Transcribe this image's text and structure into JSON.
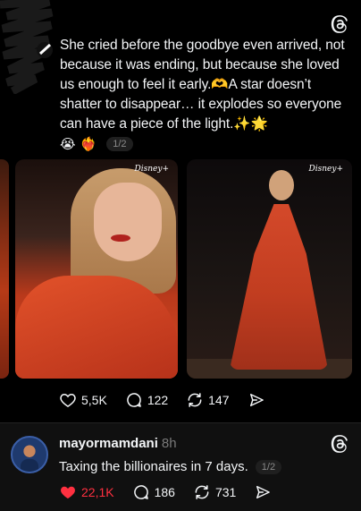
{
  "post1": {
    "text": "She cried before the goodbye even arrived, not because it was ending, but because she loved us enough to feel it early.🫶A star doesn’t shatter to disappear… it explodes so everyone can have a piece of the light.✨🌟",
    "reactions": [
      "😭",
      "❤️‍🔥"
    ],
    "pager": "1/2",
    "media": [
      {
        "watermark": "Disney+"
      },
      {
        "watermark": "Disney+"
      }
    ],
    "likes": "5,5K",
    "replies": "122",
    "reposts": "147"
  },
  "post2": {
    "username": "mayormamdani",
    "time": "8h",
    "text": "Taxing the billionaires in 7 days.",
    "pager": "1/2",
    "likes": "22,1K",
    "replies": "186",
    "reposts": "731",
    "liked": true
  },
  "colors": {
    "background": "#101010",
    "post_bg": "#000000",
    "text": "#f3f5f7",
    "muted": "#7a7a7a",
    "like_active": "#ff3040"
  },
  "icons": [
    "threads-logo-icon",
    "heart-icon",
    "reply-icon",
    "repost-icon",
    "share-icon"
  ]
}
